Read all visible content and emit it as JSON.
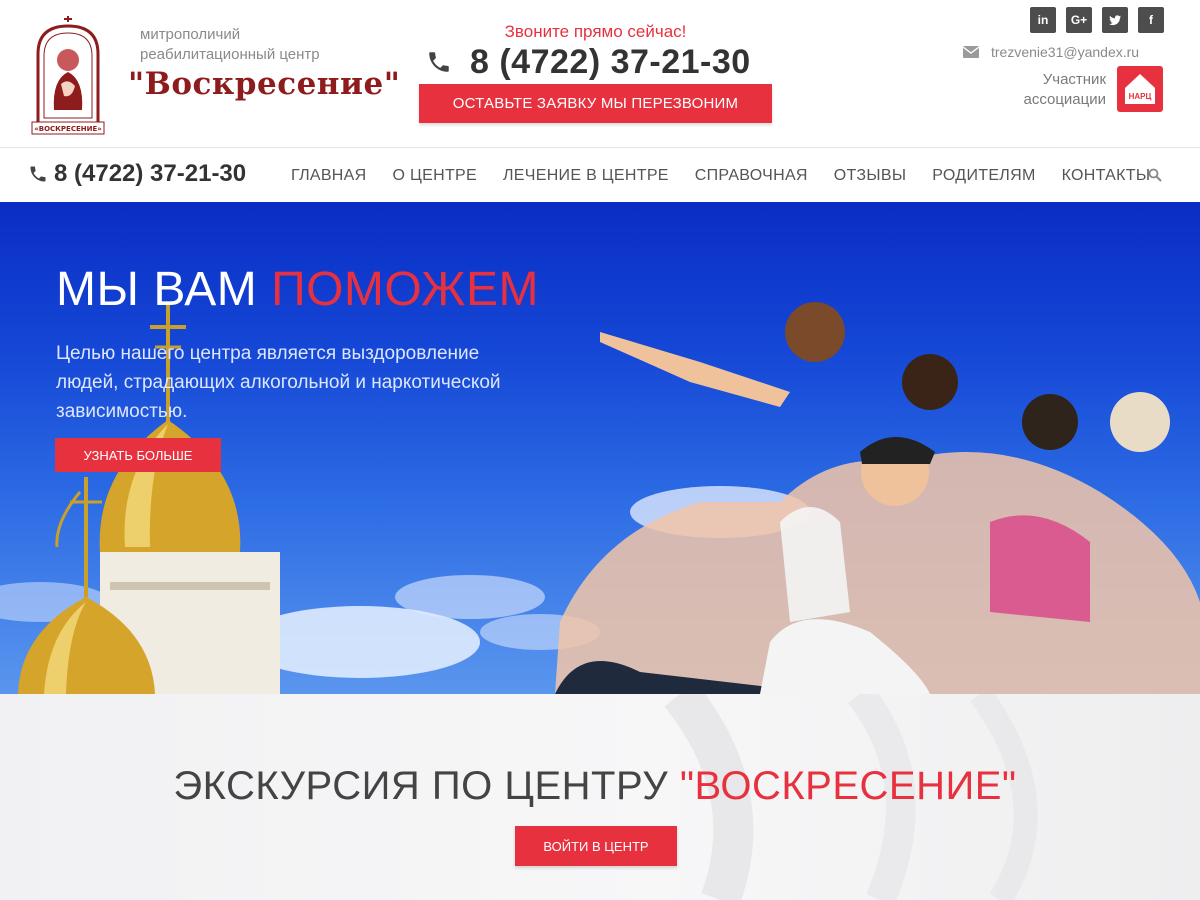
{
  "header": {
    "brand_line1": "митрополичий",
    "brand_line2": "реабилитационный центр",
    "brand_name": "\"Воскресение\"",
    "call_now": "Звоните прямо сейчас!",
    "phone": "8 (4722) 37-21-30",
    "callback_button": "ОСТАВЬТЕ ЗАЯВКУ МЫ ПЕРЕЗВОНИМ",
    "socials": [
      {
        "label": "in",
        "icon": "linkedin-icon"
      },
      {
        "label": "G+",
        "icon": "google-plus-icon"
      },
      {
        "label": "",
        "icon": "twitter-icon"
      },
      {
        "label": "f",
        "icon": "facebook-icon"
      }
    ],
    "email": "trezvenie31@yandex.ru",
    "member_line1": "Участник",
    "member_line2": "ассоциации",
    "member_badge": "НАРЦ"
  },
  "nav": {
    "phone": "8 (4722) 37-21-30",
    "items": [
      {
        "label": "ГЛАВНАЯ"
      },
      {
        "label": "О ЦЕНТРЕ"
      },
      {
        "label": "ЛЕЧЕНИЕ В ЦЕНТРЕ"
      },
      {
        "label": "СПРАВОЧНАЯ"
      },
      {
        "label": "ОТЗЫВЫ"
      },
      {
        "label": "РОДИТЕЛЯМ"
      },
      {
        "label": "КОНТАКТЫ"
      }
    ]
  },
  "hero": {
    "title_white": "МЫ ВАМ",
    "title_red": "ПОМОЖЕМ",
    "text": "Целью нашего центра является выздоровление людей, страдающих алкогольной и наркотической зависимостью.",
    "button": "УЗНАТЬ БОЛЬШЕ"
  },
  "tour": {
    "title_dark": "ЭКСКУРСИЯ ПО ЦЕНТРУ",
    "title_red": "\"ВОСКРЕСЕНИЕ\"",
    "button": "ВОЙТИ В ЦЕНТР"
  },
  "colors": {
    "accent": "#e8313f",
    "brand": "#8e1c1c",
    "sky": "#1547d6"
  }
}
